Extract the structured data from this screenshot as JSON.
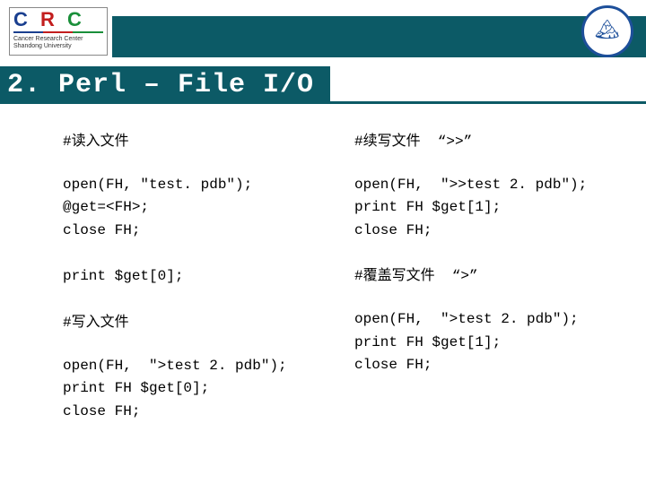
{
  "logo": {
    "letters": [
      "C",
      "R",
      "C"
    ],
    "sub1": "Cancer Research Center",
    "sub2": "Shandong University"
  },
  "seal_glyph": "🏔",
  "title": "2. Perl – File I/O",
  "left": {
    "h1": "#读入文件",
    "b1": "open(FH, \"test. pdb\");\n@get=<FH>;\nclose FH;",
    "b2": "print $get[0];",
    "h2": "#写入文件",
    "b3": "open(FH,  \">test 2. pdb\");\nprint FH $get[0];\nclose FH;"
  },
  "right": {
    "h1": "#续写文件  “>>”",
    "b1": "open(FH,  \">>test 2. pdb\");\nprint FH $get[1];\nclose FH;",
    "h2": "#覆盖写文件  “>”",
    "b2": "open(FH,  \">test 2. pdb\");\nprint FH $get[1];\nclose FH;"
  }
}
